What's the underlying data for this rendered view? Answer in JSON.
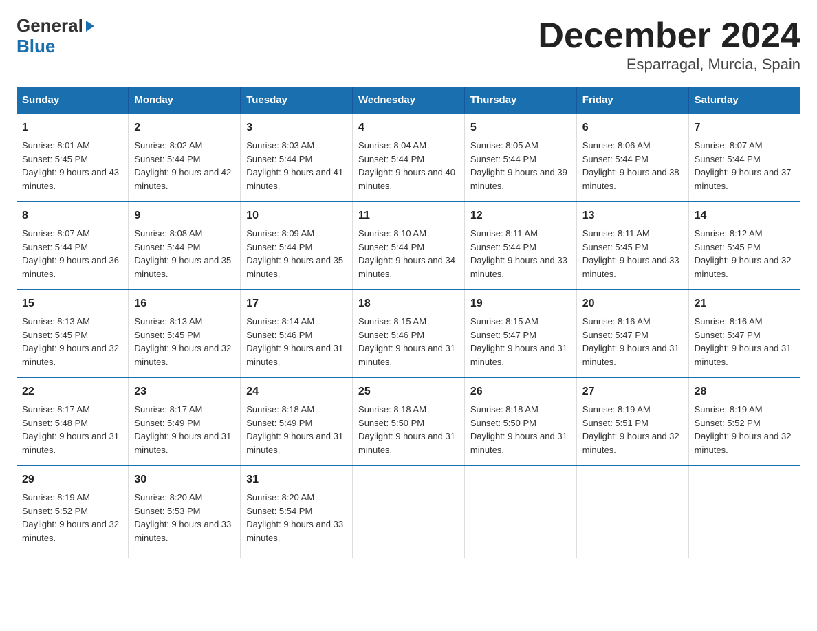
{
  "logo": {
    "line1": "General",
    "triangle": "▶",
    "line2": "Blue"
  },
  "title": "December 2024",
  "subtitle": "Esparragal, Murcia, Spain",
  "days_of_week": [
    "Sunday",
    "Monday",
    "Tuesday",
    "Wednesday",
    "Thursday",
    "Friday",
    "Saturday"
  ],
  "weeks": [
    [
      {
        "day": "1",
        "sunrise": "8:01 AM",
        "sunset": "5:45 PM",
        "daylight": "9 hours and 43 minutes."
      },
      {
        "day": "2",
        "sunrise": "8:02 AM",
        "sunset": "5:44 PM",
        "daylight": "9 hours and 42 minutes."
      },
      {
        "day": "3",
        "sunrise": "8:03 AM",
        "sunset": "5:44 PM",
        "daylight": "9 hours and 41 minutes."
      },
      {
        "day": "4",
        "sunrise": "8:04 AM",
        "sunset": "5:44 PM",
        "daylight": "9 hours and 40 minutes."
      },
      {
        "day": "5",
        "sunrise": "8:05 AM",
        "sunset": "5:44 PM",
        "daylight": "9 hours and 39 minutes."
      },
      {
        "day": "6",
        "sunrise": "8:06 AM",
        "sunset": "5:44 PM",
        "daylight": "9 hours and 38 minutes."
      },
      {
        "day": "7",
        "sunrise": "8:07 AM",
        "sunset": "5:44 PM",
        "daylight": "9 hours and 37 minutes."
      }
    ],
    [
      {
        "day": "8",
        "sunrise": "8:07 AM",
        "sunset": "5:44 PM",
        "daylight": "9 hours and 36 minutes."
      },
      {
        "day": "9",
        "sunrise": "8:08 AM",
        "sunset": "5:44 PM",
        "daylight": "9 hours and 35 minutes."
      },
      {
        "day": "10",
        "sunrise": "8:09 AM",
        "sunset": "5:44 PM",
        "daylight": "9 hours and 35 minutes."
      },
      {
        "day": "11",
        "sunrise": "8:10 AM",
        "sunset": "5:44 PM",
        "daylight": "9 hours and 34 minutes."
      },
      {
        "day": "12",
        "sunrise": "8:11 AM",
        "sunset": "5:44 PM",
        "daylight": "9 hours and 33 minutes."
      },
      {
        "day": "13",
        "sunrise": "8:11 AM",
        "sunset": "5:45 PM",
        "daylight": "9 hours and 33 minutes."
      },
      {
        "day": "14",
        "sunrise": "8:12 AM",
        "sunset": "5:45 PM",
        "daylight": "9 hours and 32 minutes."
      }
    ],
    [
      {
        "day": "15",
        "sunrise": "8:13 AM",
        "sunset": "5:45 PM",
        "daylight": "9 hours and 32 minutes."
      },
      {
        "day": "16",
        "sunrise": "8:13 AM",
        "sunset": "5:45 PM",
        "daylight": "9 hours and 32 minutes."
      },
      {
        "day": "17",
        "sunrise": "8:14 AM",
        "sunset": "5:46 PM",
        "daylight": "9 hours and 31 minutes."
      },
      {
        "day": "18",
        "sunrise": "8:15 AM",
        "sunset": "5:46 PM",
        "daylight": "9 hours and 31 minutes."
      },
      {
        "day": "19",
        "sunrise": "8:15 AM",
        "sunset": "5:47 PM",
        "daylight": "9 hours and 31 minutes."
      },
      {
        "day": "20",
        "sunrise": "8:16 AM",
        "sunset": "5:47 PM",
        "daylight": "9 hours and 31 minutes."
      },
      {
        "day": "21",
        "sunrise": "8:16 AM",
        "sunset": "5:47 PM",
        "daylight": "9 hours and 31 minutes."
      }
    ],
    [
      {
        "day": "22",
        "sunrise": "8:17 AM",
        "sunset": "5:48 PM",
        "daylight": "9 hours and 31 minutes."
      },
      {
        "day": "23",
        "sunrise": "8:17 AM",
        "sunset": "5:49 PM",
        "daylight": "9 hours and 31 minutes."
      },
      {
        "day": "24",
        "sunrise": "8:18 AM",
        "sunset": "5:49 PM",
        "daylight": "9 hours and 31 minutes."
      },
      {
        "day": "25",
        "sunrise": "8:18 AM",
        "sunset": "5:50 PM",
        "daylight": "9 hours and 31 minutes."
      },
      {
        "day": "26",
        "sunrise": "8:18 AM",
        "sunset": "5:50 PM",
        "daylight": "9 hours and 31 minutes."
      },
      {
        "day": "27",
        "sunrise": "8:19 AM",
        "sunset": "5:51 PM",
        "daylight": "9 hours and 32 minutes."
      },
      {
        "day": "28",
        "sunrise": "8:19 AM",
        "sunset": "5:52 PM",
        "daylight": "9 hours and 32 minutes."
      }
    ],
    [
      {
        "day": "29",
        "sunrise": "8:19 AM",
        "sunset": "5:52 PM",
        "daylight": "9 hours and 32 minutes."
      },
      {
        "day": "30",
        "sunrise": "8:20 AM",
        "sunset": "5:53 PM",
        "daylight": "9 hours and 33 minutes."
      },
      {
        "day": "31",
        "sunrise": "8:20 AM",
        "sunset": "5:54 PM",
        "daylight": "9 hours and 33 minutes."
      },
      {
        "day": "",
        "sunrise": "",
        "sunset": "",
        "daylight": ""
      },
      {
        "day": "",
        "sunrise": "",
        "sunset": "",
        "daylight": ""
      },
      {
        "day": "",
        "sunrise": "",
        "sunset": "",
        "daylight": ""
      },
      {
        "day": "",
        "sunrise": "",
        "sunset": "",
        "daylight": ""
      }
    ]
  ]
}
